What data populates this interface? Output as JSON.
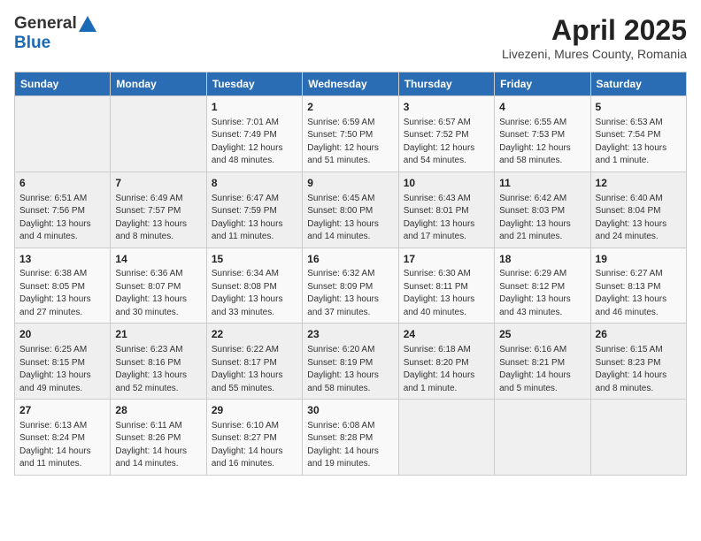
{
  "header": {
    "logo_general": "General",
    "logo_blue": "Blue",
    "month_title": "April 2025",
    "location": "Livezeni, Mures County, Romania"
  },
  "days_of_week": [
    "Sunday",
    "Monday",
    "Tuesday",
    "Wednesday",
    "Thursday",
    "Friday",
    "Saturday"
  ],
  "weeks": [
    [
      {
        "day": "",
        "info": ""
      },
      {
        "day": "",
        "info": ""
      },
      {
        "day": "1",
        "info": "Sunrise: 7:01 AM\nSunset: 7:49 PM\nDaylight: 12 hours\nand 48 minutes."
      },
      {
        "day": "2",
        "info": "Sunrise: 6:59 AM\nSunset: 7:50 PM\nDaylight: 12 hours\nand 51 minutes."
      },
      {
        "day": "3",
        "info": "Sunrise: 6:57 AM\nSunset: 7:52 PM\nDaylight: 12 hours\nand 54 minutes."
      },
      {
        "day": "4",
        "info": "Sunrise: 6:55 AM\nSunset: 7:53 PM\nDaylight: 12 hours\nand 58 minutes."
      },
      {
        "day": "5",
        "info": "Sunrise: 6:53 AM\nSunset: 7:54 PM\nDaylight: 13 hours\nand 1 minute."
      }
    ],
    [
      {
        "day": "6",
        "info": "Sunrise: 6:51 AM\nSunset: 7:56 PM\nDaylight: 13 hours\nand 4 minutes."
      },
      {
        "day": "7",
        "info": "Sunrise: 6:49 AM\nSunset: 7:57 PM\nDaylight: 13 hours\nand 8 minutes."
      },
      {
        "day": "8",
        "info": "Sunrise: 6:47 AM\nSunset: 7:59 PM\nDaylight: 13 hours\nand 11 minutes."
      },
      {
        "day": "9",
        "info": "Sunrise: 6:45 AM\nSunset: 8:00 PM\nDaylight: 13 hours\nand 14 minutes."
      },
      {
        "day": "10",
        "info": "Sunrise: 6:43 AM\nSunset: 8:01 PM\nDaylight: 13 hours\nand 17 minutes."
      },
      {
        "day": "11",
        "info": "Sunrise: 6:42 AM\nSunset: 8:03 PM\nDaylight: 13 hours\nand 21 minutes."
      },
      {
        "day": "12",
        "info": "Sunrise: 6:40 AM\nSunset: 8:04 PM\nDaylight: 13 hours\nand 24 minutes."
      }
    ],
    [
      {
        "day": "13",
        "info": "Sunrise: 6:38 AM\nSunset: 8:05 PM\nDaylight: 13 hours\nand 27 minutes."
      },
      {
        "day": "14",
        "info": "Sunrise: 6:36 AM\nSunset: 8:07 PM\nDaylight: 13 hours\nand 30 minutes."
      },
      {
        "day": "15",
        "info": "Sunrise: 6:34 AM\nSunset: 8:08 PM\nDaylight: 13 hours\nand 33 minutes."
      },
      {
        "day": "16",
        "info": "Sunrise: 6:32 AM\nSunset: 8:09 PM\nDaylight: 13 hours\nand 37 minutes."
      },
      {
        "day": "17",
        "info": "Sunrise: 6:30 AM\nSunset: 8:11 PM\nDaylight: 13 hours\nand 40 minutes."
      },
      {
        "day": "18",
        "info": "Sunrise: 6:29 AM\nSunset: 8:12 PM\nDaylight: 13 hours\nand 43 minutes."
      },
      {
        "day": "19",
        "info": "Sunrise: 6:27 AM\nSunset: 8:13 PM\nDaylight: 13 hours\nand 46 minutes."
      }
    ],
    [
      {
        "day": "20",
        "info": "Sunrise: 6:25 AM\nSunset: 8:15 PM\nDaylight: 13 hours\nand 49 minutes."
      },
      {
        "day": "21",
        "info": "Sunrise: 6:23 AM\nSunset: 8:16 PM\nDaylight: 13 hours\nand 52 minutes."
      },
      {
        "day": "22",
        "info": "Sunrise: 6:22 AM\nSunset: 8:17 PM\nDaylight: 13 hours\nand 55 minutes."
      },
      {
        "day": "23",
        "info": "Sunrise: 6:20 AM\nSunset: 8:19 PM\nDaylight: 13 hours\nand 58 minutes."
      },
      {
        "day": "24",
        "info": "Sunrise: 6:18 AM\nSunset: 8:20 PM\nDaylight: 14 hours\nand 1 minute."
      },
      {
        "day": "25",
        "info": "Sunrise: 6:16 AM\nSunset: 8:21 PM\nDaylight: 14 hours\nand 5 minutes."
      },
      {
        "day": "26",
        "info": "Sunrise: 6:15 AM\nSunset: 8:23 PM\nDaylight: 14 hours\nand 8 minutes."
      }
    ],
    [
      {
        "day": "27",
        "info": "Sunrise: 6:13 AM\nSunset: 8:24 PM\nDaylight: 14 hours\nand 11 minutes."
      },
      {
        "day": "28",
        "info": "Sunrise: 6:11 AM\nSunset: 8:26 PM\nDaylight: 14 hours\nand 14 minutes."
      },
      {
        "day": "29",
        "info": "Sunrise: 6:10 AM\nSunset: 8:27 PM\nDaylight: 14 hours\nand 16 minutes."
      },
      {
        "day": "30",
        "info": "Sunrise: 6:08 AM\nSunset: 8:28 PM\nDaylight: 14 hours\nand 19 minutes."
      },
      {
        "day": "",
        "info": ""
      },
      {
        "day": "",
        "info": ""
      },
      {
        "day": "",
        "info": ""
      }
    ]
  ]
}
